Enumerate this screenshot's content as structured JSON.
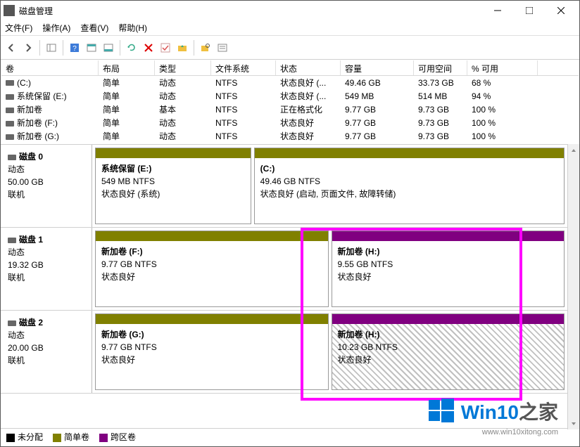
{
  "window": {
    "title": "磁盘管理"
  },
  "menu": {
    "file": "文件(F)",
    "action": "操作(A)",
    "view": "查看(V)",
    "help": "帮助(H)"
  },
  "columns": [
    "卷",
    "布局",
    "类型",
    "文件系统",
    "状态",
    "容量",
    "可用空间",
    "% 可用"
  ],
  "volumes": [
    {
      "name": "(C:)",
      "layout": "简单",
      "type": "动态",
      "fs": "NTFS",
      "status": "状态良好 (...",
      "capacity": "49.46 GB",
      "free": "33.73 GB",
      "pct": "68 %"
    },
    {
      "name": "系统保留 (E:)",
      "layout": "简单",
      "type": "动态",
      "fs": "NTFS",
      "status": "状态良好 (...",
      "capacity": "549 MB",
      "free": "514 MB",
      "pct": "94 %"
    },
    {
      "name": "新加卷",
      "layout": "简单",
      "type": "基本",
      "fs": "NTFS",
      "status": "正在格式化",
      "capacity": "9.77 GB",
      "free": "9.73 GB",
      "pct": "100 %"
    },
    {
      "name": "新加卷 (F:)",
      "layout": "简单",
      "type": "动态",
      "fs": "NTFS",
      "status": "状态良好",
      "capacity": "9.77 GB",
      "free": "9.73 GB",
      "pct": "100 %"
    },
    {
      "name": "新加卷 (G:)",
      "layout": "简单",
      "type": "动态",
      "fs": "NTFS",
      "status": "状态良好",
      "capacity": "9.77 GB",
      "free": "9.73 GB",
      "pct": "100 %"
    }
  ],
  "disks": [
    {
      "label": "磁盘 0",
      "type": "动态",
      "size": "50.00 GB",
      "status": "联机",
      "vols": [
        {
          "bar": "olive",
          "line1": "系统保留   (E:)",
          "line2": "549 MB NTFS",
          "line3": "状态良好 (系统)",
          "flex": 1
        },
        {
          "bar": "olive",
          "line1": "(C:)",
          "line2": "49.46 GB NTFS",
          "line3": "状态良好 (启动, 页面文件, 故障转储)",
          "flex": 2
        }
      ]
    },
    {
      "label": "磁盘 1",
      "type": "动态",
      "size": "19.32 GB",
      "status": "联机",
      "vols": [
        {
          "bar": "olive",
          "line1": "新加卷   (F:)",
          "line2": "9.77 GB NTFS",
          "line3": "状态良好",
          "flex": 1
        },
        {
          "bar": "purple",
          "line1": "新加卷   (H:)",
          "line2": "9.55 GB NTFS",
          "line3": "状态良好",
          "flex": 1
        }
      ]
    },
    {
      "label": "磁盘 2",
      "type": "动态",
      "size": "20.00 GB",
      "status": "联机",
      "vols": [
        {
          "bar": "olive",
          "line1": "新加卷   (G:)",
          "line2": "9.77 GB NTFS",
          "line3": "状态良好",
          "flex": 1
        },
        {
          "bar": "purple",
          "line1": "新加卷   (H:)",
          "line2": "10.23 GB NTFS",
          "line3": "状态良好",
          "flex": 1,
          "hatched": true
        }
      ]
    }
  ],
  "legend": {
    "unalloc": "未分配",
    "simple": "简单卷",
    "spanned": "跨区卷"
  },
  "watermark": {
    "brand_a": "Win10",
    "brand_b": "之家",
    "url": "www.win10xitong.com"
  }
}
